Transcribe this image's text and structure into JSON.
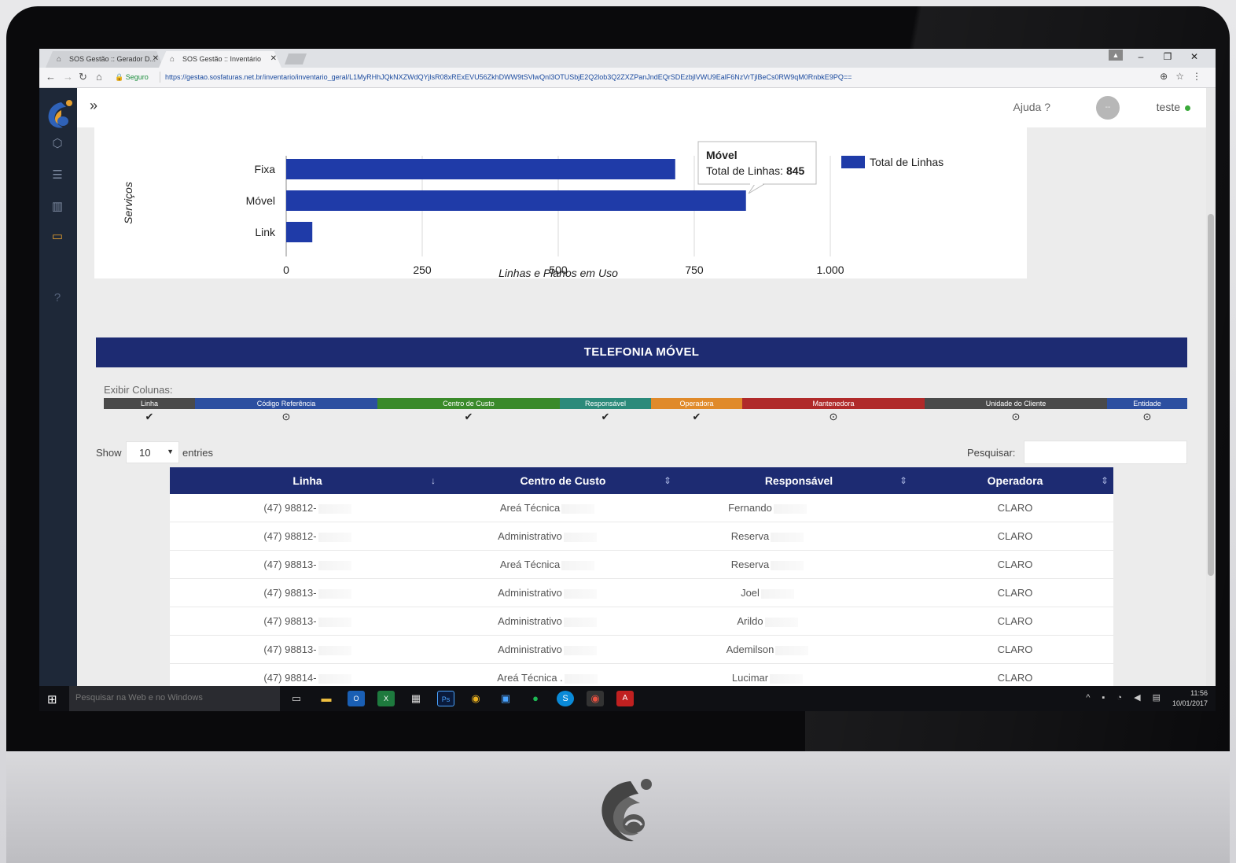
{
  "browser": {
    "tabs": [
      {
        "title": "SOS Gestão :: Gerador D..."
      },
      {
        "title": "SOS Gestão :: Inventário"
      }
    ],
    "secure_label": "Seguro",
    "url": "https://gestao.sosfaturas.net.br/inventario/inventario_geral/L1MyRHhJQkNXZWdQYjlsR08xRExEVU56ZkhDWW9tSVlwQnl3OTUSbjE2Q2lob3Q2ZXZPanJndEQrSDEzbjlVWU9EalF6NzVrTjlBeCs0RW9qM0RnbkE9PQ=="
  },
  "app": {
    "help_label": "Ajuda",
    "help_icon": "?",
    "avatar_initials": "--",
    "user_name": "teste"
  },
  "chart_data": {
    "type": "bar",
    "orientation": "horizontal",
    "categories": [
      "Fixa",
      "Móvel",
      "Link"
    ],
    "series": [
      {
        "name": "Total de Linhas",
        "values": [
          715,
          845,
          48
        ],
        "color": "#1f3ba8"
      }
    ],
    "xlabel": "Linhas e Planos em Uso",
    "ylabel": "Serviços",
    "xlim": [
      0,
      1000
    ],
    "x_ticks": [
      "0",
      "250",
      "500",
      "750",
      "1.000"
    ],
    "legend": "top-right",
    "tooltip": {
      "title": "Móvel",
      "label": "Total de Linhas:",
      "value": "845"
    }
  },
  "section": {
    "title": "TELEFONIA MÓVEL",
    "columns_label": "Exibir Colunas:"
  },
  "column_toggles": [
    {
      "label": "Linha",
      "color": "#4a4a4a",
      "state": "✔"
    },
    {
      "label": "Código Referência",
      "color": "#2c4fa0",
      "state": "⊙"
    },
    {
      "label": "Centro de Custo",
      "color": "#3a8a2a",
      "state": "✔"
    },
    {
      "label": "Responsável",
      "color": "#2b8a7a",
      "state": "✔"
    },
    {
      "label": "Operadora",
      "color": "#e08a2a",
      "state": "✔"
    },
    {
      "label": "Mantenedora",
      "color": "#b02a2a",
      "state": "⊙"
    },
    {
      "label": "Unidade do Cliente",
      "color": "#4a4a4a",
      "state": "⊙"
    },
    {
      "label": "Entidade",
      "color": "#2c4fa0",
      "state": "⊙"
    }
  ],
  "table_controls": {
    "show_label": "Show",
    "entries_value": "10",
    "entries_label": "entries",
    "search_label": "Pesquisar:",
    "search_value": ""
  },
  "table": {
    "headers": [
      "Linha",
      "Centro de Custo",
      "Responsável",
      "Operadora"
    ],
    "rows": [
      [
        "(47) 98812-",
        "Areá Técnica",
        "Fernando",
        "CLARO"
      ],
      [
        "(47) 98812-",
        "Administrativo",
        "Reserva",
        "CLARO"
      ],
      [
        "(47) 98813-",
        "Areá Técnica",
        "Reserva",
        "CLARO"
      ],
      [
        "(47) 98813-",
        "Administrativo",
        "Joel",
        "CLARO"
      ],
      [
        "(47) 98813-",
        "Administrativo",
        "Arildo",
        "CLARO"
      ],
      [
        "(47) 98813-",
        "Administrativo",
        "Ademilson",
        "CLARO"
      ],
      [
        "(47) 98814-",
        "Areá Técnica .",
        "Lucimar",
        "CLARO"
      ]
    ]
  },
  "taskbar": {
    "search_placeholder": "Pesquisar na Web e no Windows",
    "time": "11:56",
    "date": "10/01/2017"
  }
}
